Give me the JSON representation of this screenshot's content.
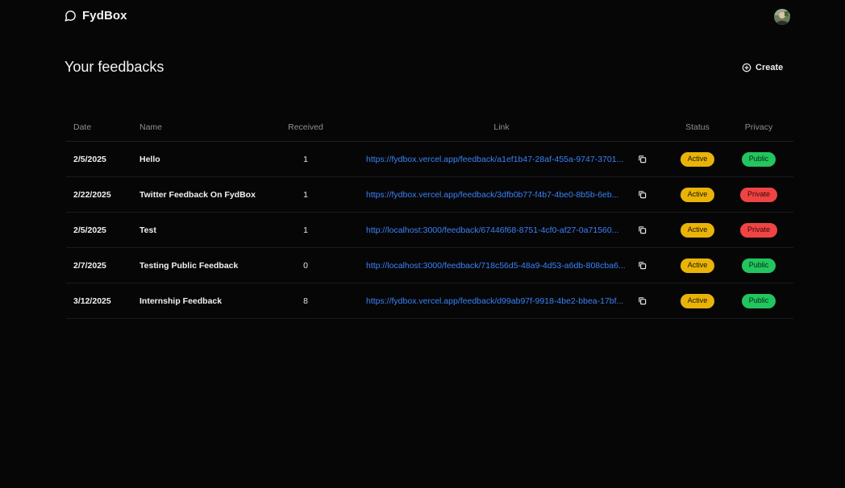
{
  "header": {
    "brand": "FydBox",
    "brand_icon": "message-circle-icon",
    "avatar_icon": "user-avatar"
  },
  "page": {
    "title": "Your feedbacks",
    "create_label": "Create",
    "create_icon": "plus-circle-icon"
  },
  "table": {
    "columns": {
      "date": "Date",
      "name": "Name",
      "received": "Received",
      "link": "Link",
      "status": "Status",
      "privacy": "Privacy"
    },
    "rows": [
      {
        "date": "2/5/2025",
        "name": "Hello",
        "received": "1",
        "link": "https://fydbox.vercel.app/feedback/a1ef1b47-28af-455a-9747-3701...",
        "status": "Active",
        "privacy": "Public"
      },
      {
        "date": "2/22/2025",
        "name": "Twitter Feedback On FydBox",
        "received": "1",
        "link": "https://fydbox.vercel.app/feedback/3dfb0b77-f4b7-4be0-8b5b-6eb...",
        "status": "Active",
        "privacy": "Private"
      },
      {
        "date": "2/5/2025",
        "name": "Test",
        "received": "1",
        "link": "http://localhost:3000/feedback/67446f68-8751-4cf0-af27-0a71560...",
        "status": "Active",
        "privacy": "Private"
      },
      {
        "date": "2/7/2025",
        "name": "Testing Public Feedback",
        "received": "0",
        "link": "http://localhost:3000/feedback/718c56d5-48a9-4d53-a6db-808cba6...",
        "status": "Active",
        "privacy": "Public"
      },
      {
        "date": "3/12/2025",
        "name": "Internship Feedback",
        "received": "8",
        "link": "https://fydbox.vercel.app/feedback/d99ab97f-9918-4be2-bbea-17bf...",
        "status": "Active",
        "privacy": "Public"
      }
    ]
  },
  "colors": {
    "background": "#060607",
    "link": "#3b82f6",
    "active": "#eab308",
    "public": "#22c55e",
    "private": "#ef4444"
  }
}
